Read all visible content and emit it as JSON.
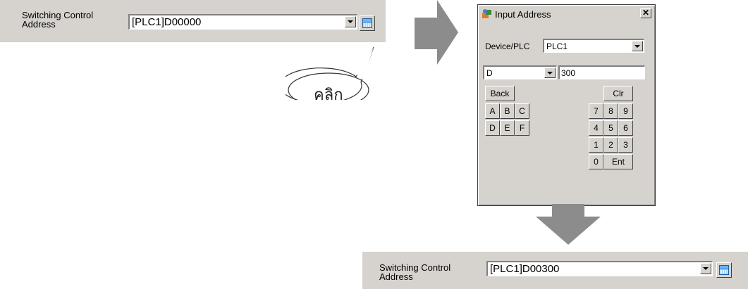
{
  "top_field": {
    "label": "Switching Control\nAddress",
    "value": "[PLC1]D00000"
  },
  "callout": {
    "text": "คลิก"
  },
  "dialog": {
    "title": "Input Address",
    "close_label": "✕",
    "device_label": "Device/PLC",
    "device_value": "PLC1",
    "device_type_value": "D",
    "address_value": "300",
    "keys": {
      "back": "Back",
      "clr": "Clr",
      "a": "A",
      "b": "B",
      "c": "C",
      "d": "D",
      "e": "E",
      "f": "F",
      "n7": "7",
      "n8": "8",
      "n9": "9",
      "n4": "4",
      "n5": "5",
      "n6": "6",
      "n1": "1",
      "n2": "2",
      "n3": "3",
      "n0": "0",
      "ent": "Ent"
    }
  },
  "bottom_field": {
    "label": "Switching Control\nAddress",
    "value": "[PLC1]D00300"
  },
  "colors": {
    "panel": "#d6d3ce",
    "arrow": "#8c8c8c"
  }
}
